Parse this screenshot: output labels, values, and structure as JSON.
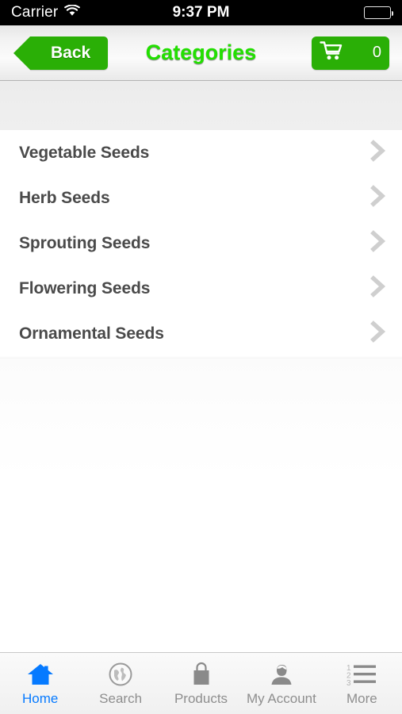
{
  "status_bar": {
    "carrier": "Carrier",
    "wifi_icon": "wifi-icon",
    "time": "9:37 PM",
    "battery_icon": "battery-full-icon"
  },
  "nav_bar": {
    "back_label": "Back",
    "back_icon": "back-arrow-icon",
    "title": "Categories",
    "cart_icon": "shopping-cart-icon",
    "cart_count": "0",
    "accent_green": "#2aaf06",
    "title_green": "#22e000"
  },
  "categories": [
    {
      "label": "Vegetable Seeds",
      "chevron": "chevron-right-icon"
    },
    {
      "label": "Herb Seeds",
      "chevron": "chevron-right-icon"
    },
    {
      "label": "Sprouting Seeds",
      "chevron": "chevron-right-icon"
    },
    {
      "label": "Flowering Seeds",
      "chevron": "chevron-right-icon"
    },
    {
      "label": "Ornamental Seeds",
      "chevron": "chevron-right-icon"
    }
  ],
  "tab_bar": {
    "active_color": "#067aff",
    "inactive_color": "#8e8e8e",
    "tabs": [
      {
        "label": "Home",
        "icon": "house-icon",
        "active": true
      },
      {
        "label": "Search",
        "icon": "globe-icon",
        "active": false
      },
      {
        "label": "Products",
        "icon": "shopping-bag-icon",
        "active": false
      },
      {
        "label": "My Account",
        "icon": "person-icon",
        "active": false
      },
      {
        "label": "More",
        "icon": "numbered-list-icon",
        "active": false
      }
    ]
  }
}
